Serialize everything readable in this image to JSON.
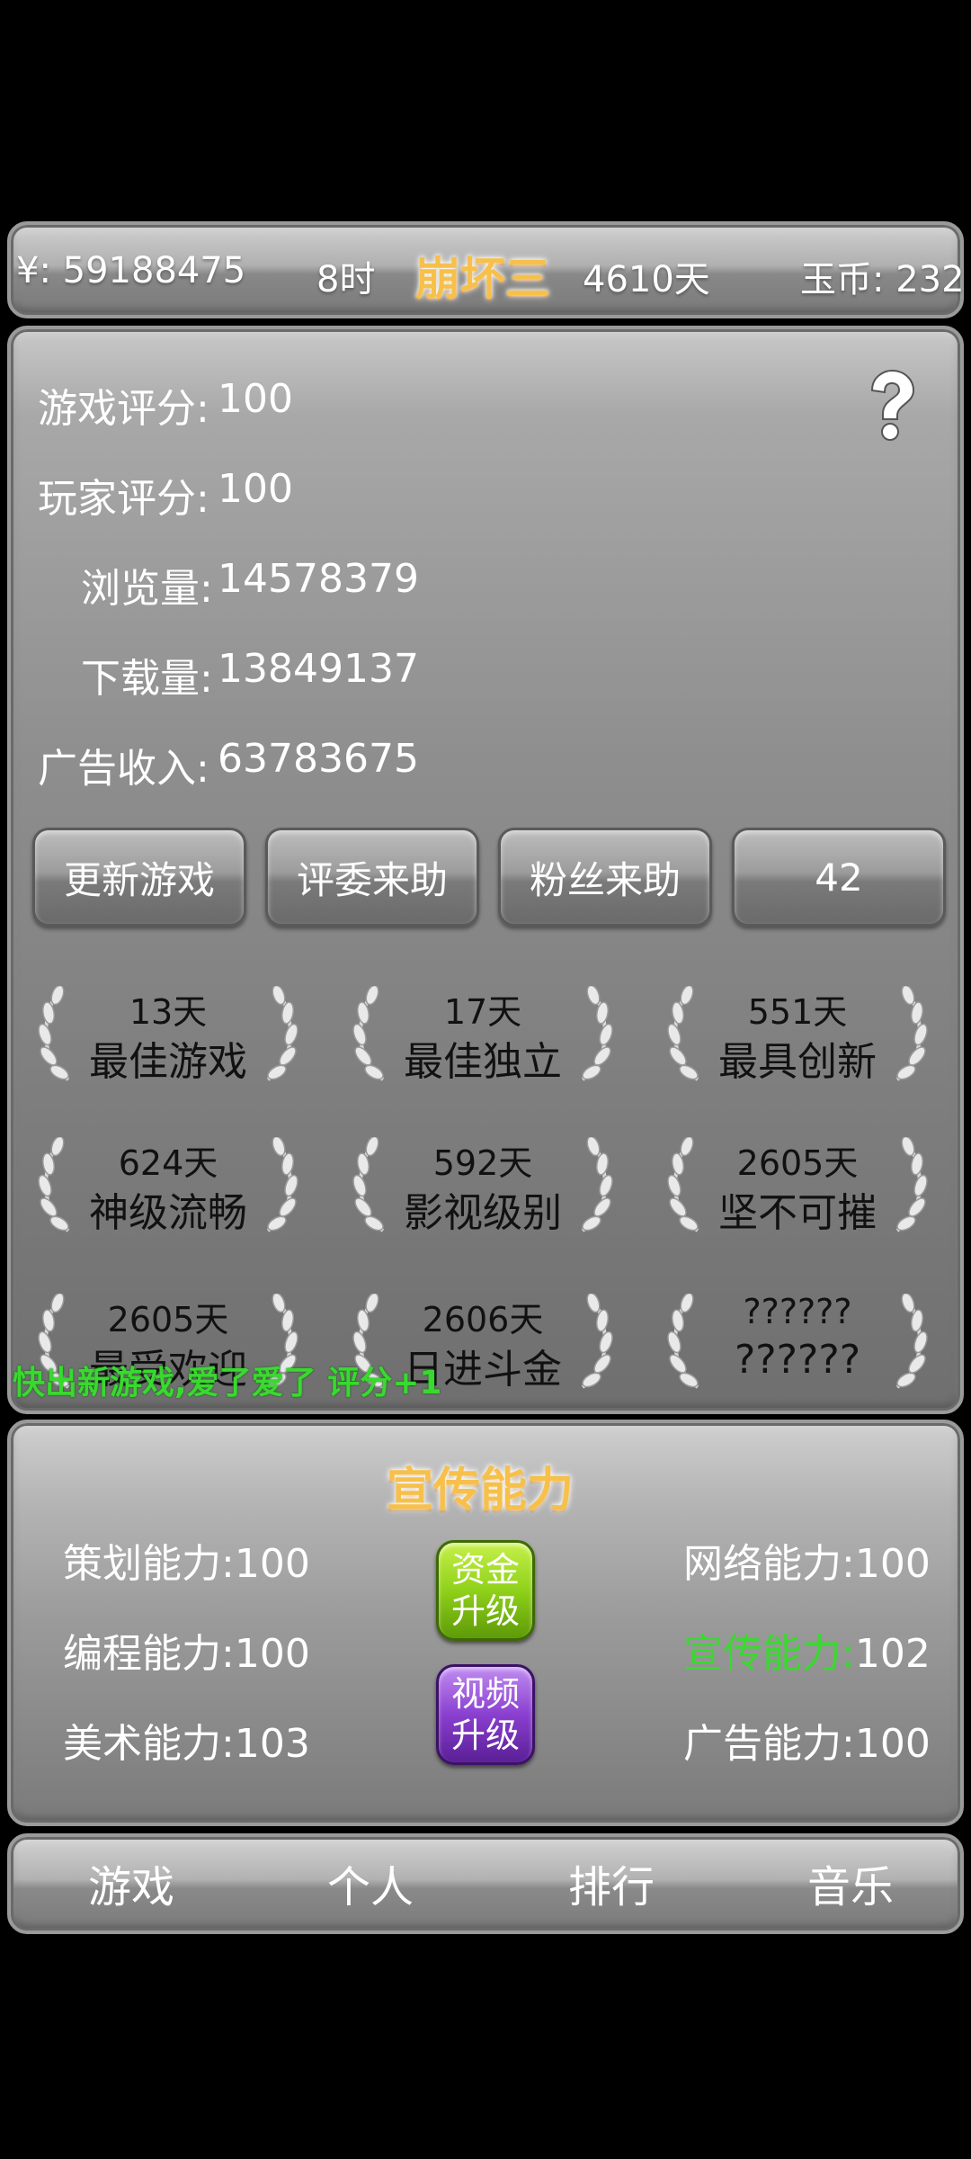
{
  "topbar": {
    "money": "¥: 59188475",
    "hour": "8时",
    "game_title": "崩坏三",
    "days": "4610天",
    "jade": "玉币: 232"
  },
  "stats": [
    {
      "label": "游戏评分:",
      "value": "100"
    },
    {
      "label": "玩家评分:",
      "value": "100"
    },
    {
      "label": "浏览量:",
      "value": "14578379"
    },
    {
      "label": "下载量:",
      "value": "13849137"
    },
    {
      "label": "广告收入:",
      "value": "63783675"
    }
  ],
  "help_icon": "question-mark-icon",
  "actions": {
    "update": "更新游戏",
    "judges": "评委来助",
    "fans": "粉丝来助",
    "counter": "42"
  },
  "awards": [
    {
      "days": "13天",
      "name": "最佳游戏"
    },
    {
      "days": "17天",
      "name": "最佳独立"
    },
    {
      "days": "551天",
      "name": "最具创新"
    },
    {
      "days": "624天",
      "name": "神级流畅"
    },
    {
      "days": "592天",
      "name": "影视级别"
    },
    {
      "days": "2605天",
      "name": "坚不可摧"
    },
    {
      "days": "2605天",
      "name": "最受欢迎"
    },
    {
      "days": "2606天",
      "name": "日进斗金"
    },
    {
      "days": "??????",
      "name": "??????"
    }
  ],
  "ticker": "快出新游戏,爱了爱了   评分+1",
  "abilities": {
    "title": "宣传能力",
    "planning": {
      "label": "策划能力:",
      "value": "100"
    },
    "programming": {
      "label": "编程能力:",
      "value": "100"
    },
    "art": {
      "label": "美术能力:",
      "value": "103"
    },
    "network": {
      "label": "网络能力:",
      "value": "100"
    },
    "promotion": {
      "label": "宣传能力:",
      "value": "102"
    },
    "ads": {
      "label": "广告能力:",
      "value": "100"
    },
    "fund_upgrade": [
      "资金",
      "升级"
    ],
    "video_upgrade": [
      "视频",
      "升级"
    ]
  },
  "nav": {
    "game": "游戏",
    "personal": "个人",
    "rank": "排行",
    "music": "音乐"
  },
  "colors": {
    "title_orange": "#f6c04a",
    "highlight_green": "#39d92f",
    "fund_button": "#8fd11a",
    "video_button": "#8a3fd0"
  }
}
